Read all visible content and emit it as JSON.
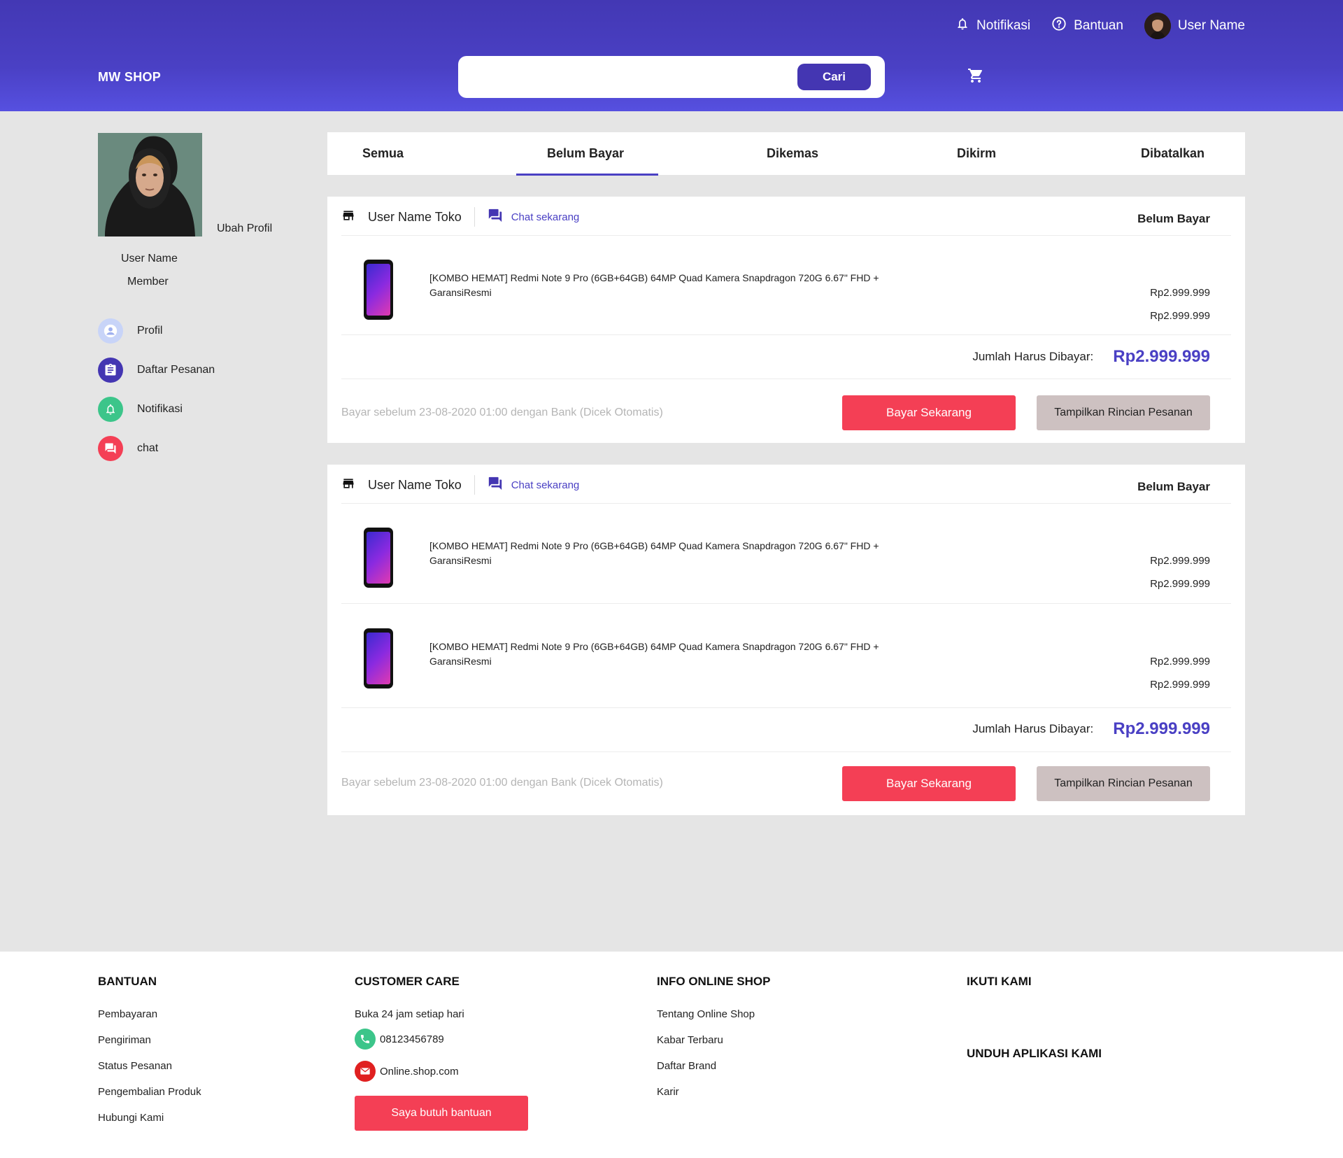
{
  "header": {
    "topnav": {
      "notifications": "Notifikasi",
      "help": "Bantuan",
      "username": "User Name"
    },
    "logo": "MW SHOP",
    "search": {
      "placeholder": "",
      "button": "Cari"
    },
    "icons": {
      "cart": "cart-icon",
      "bell": "bell-icon",
      "help": "help-circle-icon"
    }
  },
  "sidebar": {
    "edit_profile": "Ubah Profil",
    "username": "User Name",
    "role": "Member",
    "items": [
      {
        "label": "Profil",
        "icon": "user-icon",
        "color": "#c8d4f8"
      },
      {
        "label": "Daftar Pesanan",
        "icon": "clipboard-icon",
        "color": "#4436b2"
      },
      {
        "label": "Notifikasi",
        "icon": "bell-icon",
        "color": "#3cc58a"
      },
      {
        "label": "chat",
        "icon": "chat-icon",
        "color": "#f43f55"
      }
    ]
  },
  "tabs": [
    {
      "label": "Semua"
    },
    {
      "label": "Belum Bayar",
      "active": true
    },
    {
      "label": "Dikemas"
    },
    {
      "label": "Dikirm"
    },
    {
      "label": "Dibatalkan"
    }
  ],
  "orders": [
    {
      "shop": "User Name Toko",
      "chat": "Chat sekarang",
      "status": "Belum Bayar",
      "products": [
        {
          "name": "[KOMBO HEMAT] Redmi Note 9 Pro (6GB+64GB)  64MP Quad Kamera Snapdragon 720G 6.67\" FHD + GaransiResmi",
          "price1": "Rp2.999.999",
          "price2": "Rp2.999.999"
        }
      ],
      "total_label": "Jumlah Harus Dibayar:",
      "total": "Rp2.999.999",
      "deadline": "Bayar sebelum 23-08-2020 01:00 dengan Bank (Dicek Otomatis)",
      "pay_button": "Bayar Sekarang",
      "detail_button": "Tampilkan Rincian Pesanan"
    },
    {
      "shop": "User Name Toko",
      "chat": "Chat sekarang",
      "status": "Belum Bayar",
      "products": [
        {
          "name": "[KOMBO HEMAT] Redmi Note 9 Pro (6GB+64GB)  64MP Quad Kamera Snapdragon 720G 6.67\" FHD + GaransiResmi",
          "price1": "Rp2.999.999",
          "price2": "Rp2.999.999"
        },
        {
          "name": "[KOMBO HEMAT] Redmi Note 9 Pro (6GB+64GB)  64MP Quad Kamera Snapdragon 720G 6.67\" FHD + GaransiResmi",
          "price1": "Rp2.999.999",
          "price2": "Rp2.999.999"
        }
      ],
      "total_label": "Jumlah Harus Dibayar:",
      "total": "Rp2.999.999",
      "deadline": "Bayar sebelum 23-08-2020 01:00 dengan Bank (Dicek Otomatis)",
      "pay_button": "Bayar Sekarang",
      "detail_button": "Tampilkan Rincian Pesanan"
    }
  ],
  "footer": {
    "bantuan": {
      "title": "BANTUAN",
      "links": [
        "Pembayaran",
        "Pengiriman",
        "Status Pesanan",
        "Pengembalian Produk",
        "Hubungi Kami"
      ]
    },
    "customer_care": {
      "title": "CUSTOMER CARE",
      "hours": "Buka 24 jam setiap hari",
      "phone": "08123456789",
      "email": "Online.shop.com",
      "button": "Saya butuh bantuan"
    },
    "info": {
      "title": "INFO ONLINE SHOP",
      "links": [
        "Tentang Online Shop",
        "Kabar Terbaru",
        "Daftar Brand",
        "Karir"
      ]
    },
    "follow": {
      "title": "IKUTI KAMI"
    },
    "download": {
      "title": "UNDUH APLIKASI KAMI"
    }
  },
  "colors": {
    "primary": "#4436b2",
    "accent": "#f43f55",
    "secondary_button": "#cdc1c1",
    "background": "#e5e5e5"
  }
}
